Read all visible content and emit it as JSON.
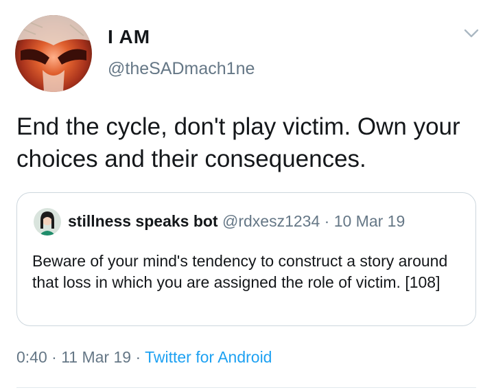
{
  "author": {
    "display_name": "I AM",
    "handle": "@theSADmach1ne",
    "avatar_icon": "profile-avatar"
  },
  "tweet": {
    "text": "End the cycle, don't play victim. Own your choices and their consequences."
  },
  "quoted_tweet": {
    "display_name": "stillness speaks bot",
    "handle": "@rdxesz1234",
    "separator": " · ",
    "date": "10 Mar 19",
    "text": "Beware of your mind's tendency to construct a story around that loss in which you are assigned the role of victim. [108]"
  },
  "meta": {
    "time": "0:40",
    "separator1": " · ",
    "date": "11 Mar 19",
    "separator2": " · ",
    "source": "Twitter for Android"
  },
  "icons": {
    "menu": "chevron-down-icon"
  },
  "colors": {
    "text": "#14171a",
    "secondary": "#657786",
    "link": "#1da1f2",
    "border": "#ccd6dd"
  }
}
